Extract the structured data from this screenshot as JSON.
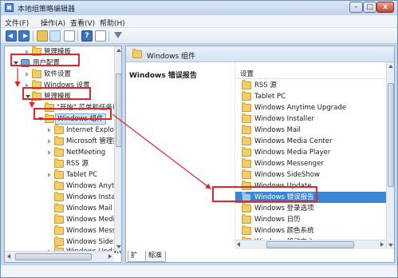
{
  "window": {
    "title": "本地组策略编辑器",
    "min": "–",
    "max": "□",
    "close": "x"
  },
  "menu": {
    "file": "文件(F)",
    "action": "操作(A)",
    "view": "查看(V)",
    "help": "帮助(H)"
  },
  "toolbar": {
    "help_glyph": "?"
  },
  "tree": {
    "items": [
      {
        "label": "管理模板"
      },
      {
        "label": "用户配置"
      },
      {
        "label": "软件设置"
      },
      {
        "label": "Windows 设置"
      },
      {
        "label": "管理模板"
      },
      {
        "label": "\"开始\" 菜单和任务栏"
      },
      {
        "label": "Windows 组件"
      },
      {
        "label": "Internet Explorer"
      },
      {
        "label": "Microsoft 管理控制台"
      },
      {
        "label": "NetMeeting"
      },
      {
        "label": "RSS 源"
      },
      {
        "label": "Tablet PC"
      },
      {
        "label": "Windows Anytime Upgrade"
      },
      {
        "label": "Windows Installer"
      },
      {
        "label": "Windows Mail"
      },
      {
        "label": "Windows Media Center"
      },
      {
        "label": "Windows Messenger"
      },
      {
        "label": "Windows SideShow"
      },
      {
        "label": "Windows Update"
      }
    ]
  },
  "right": {
    "header_title": "Windows 组件",
    "description_title": "Windows 错误报告",
    "column_header": "设置",
    "items": [
      {
        "label": "RSS 源"
      },
      {
        "label": "Tablet PC"
      },
      {
        "label": "Windows Anytime Upgrade"
      },
      {
        "label": "Windows Installer"
      },
      {
        "label": "Windows Mail"
      },
      {
        "label": "Windows Media Center"
      },
      {
        "label": "Windows Media Player"
      },
      {
        "label": "Windows Messenger"
      },
      {
        "label": "Windows SideShow"
      },
      {
        "label": "Windows Update"
      },
      {
        "label": "Windows 错误报告"
      },
      {
        "label": "Windows 登录选项"
      },
      {
        "label": "Windows 日历"
      },
      {
        "label": "Windows 颜色系统"
      },
      {
        "label": "Windows 移动中心"
      }
    ],
    "tabs": {
      "extended": "扩展",
      "standard": "标准"
    }
  },
  "colors": {
    "annotation": "#e3242b",
    "selection": "#3a86d6",
    "folder": "#f2ce6a"
  }
}
